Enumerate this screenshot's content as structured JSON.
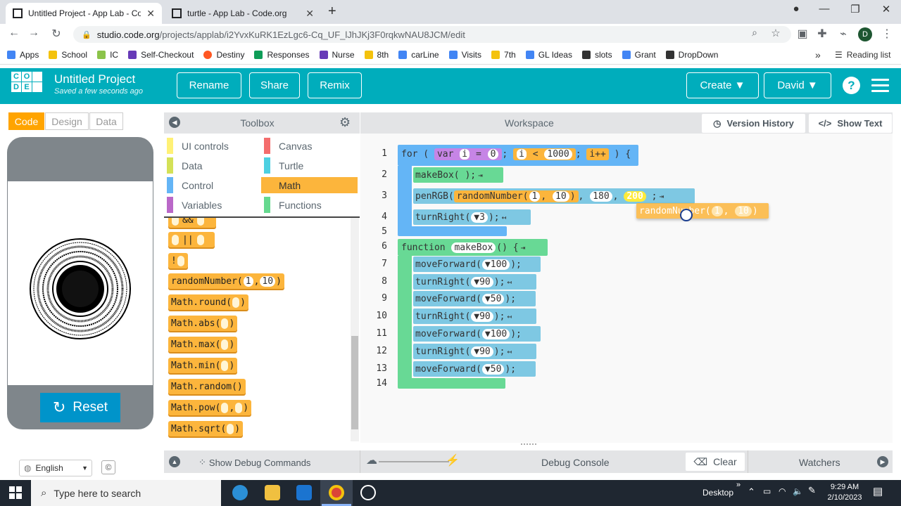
{
  "browser": {
    "tabs": [
      {
        "title": "Untitled Project - App Lab - Code",
        "active": true
      },
      {
        "title": "turtle - App Lab - Code.org",
        "active": false
      }
    ],
    "new_tab": "+",
    "url_host": "studio.code.org",
    "url_path": "/projects/applab/i2YvxKuRK1EzLgc6-Cq_UF_lJhJKj3F0rqkwNAU8JCM/edit",
    "bookmarks": [
      "Apps",
      "School",
      "IC",
      "Self-Checkout",
      "Destiny",
      "Responses",
      "Nurse",
      "8th",
      "carLine",
      "Visits",
      "7th",
      "GL Ideas",
      "slots",
      "Grant",
      "DropDown"
    ],
    "bookmark_more": "»",
    "reading_list": "Reading list",
    "profile_initial": "D"
  },
  "header": {
    "logo_letters": [
      "C",
      "O",
      "D",
      "E"
    ],
    "title": "Untitled Project",
    "subtitle": "Saved a few seconds ago",
    "buttons": {
      "rename": "Rename",
      "share": "Share",
      "remix": "Remix",
      "create": "Create ▼",
      "user": "David ▼"
    },
    "help": "?"
  },
  "left": {
    "mode_tabs": [
      "Code",
      "Design",
      "Data"
    ],
    "reset_label": "Reset",
    "language": "English",
    "cc": "©"
  },
  "toolbox": {
    "title": "Toolbox",
    "categories": [
      {
        "label": "UI controls",
        "color": "#fff176"
      },
      {
        "label": "Canvas",
        "color": "#f46d6d"
      },
      {
        "label": "Data",
        "color": "#d4e157"
      },
      {
        "label": "Turtle",
        "color": "#4dd0e1"
      },
      {
        "label": "Control",
        "color": "#64b5f6"
      },
      {
        "label": "Math",
        "color": "#fcb53c"
      },
      {
        "label": "Variables",
        "color": "#ba68c8"
      },
      {
        "label": "Functions",
        "color": "#66d98f"
      }
    ],
    "blocks": [
      "_ && _",
      "_ || _",
      "!_",
      "randomNumber(1, 10)",
      "Math.round(_)",
      "Math.abs(_)",
      "Math.max(_)",
      "Math.min(_)",
      "Math.random()",
      "Math.pow(_, _)",
      "Math.sqrt(_)"
    ],
    "random_args": [
      "1",
      "10"
    ]
  },
  "workspace": {
    "title": "Workspace",
    "version_history": "Version History",
    "show_text": "Show Text",
    "line_numbers": [
      "1",
      "2",
      "3",
      "4",
      "5",
      "6",
      "7",
      "8",
      "9",
      "10",
      "11",
      "12",
      "13",
      "14"
    ],
    "code": {
      "l1_for": "for",
      "l1_var": "var",
      "l1_i": "i",
      "l1_eq": "=",
      "l1_zero": "0",
      "l1_cond_i": "i",
      "l1_lt": "<",
      "l1_limit": "1000",
      "l1_inc": "i++",
      "l2": "makeBox",
      "l3_fn": "penRGB",
      "l3_rand": "randomNumber",
      "l3_a": "1",
      "l3_b": "10",
      "l3_g": "180",
      "l3_b2": "200",
      "l4_fn": "turnRight",
      "l4_arg": "3",
      "l6_function": "function",
      "l6_name": "makeBox",
      "l7": "moveForward",
      "l7_arg": "100",
      "l8": "turnRight",
      "l8_arg": "90",
      "l9": "moveForward",
      "l9_arg": "50",
      "l10": "turnRight",
      "l10_arg": "90",
      "l11": "moveForward",
      "l11_arg": "100",
      "l12": "turnRight",
      "l12_arg": "90",
      "l13": "moveForward",
      "l13_arg": "50",
      "drag_block": "randomNumber",
      "drag_a": "1",
      "drag_b": "10"
    }
  },
  "debug": {
    "show_debug": "Show Debug Commands",
    "console": "Debug Console",
    "clear": "Clear",
    "watchers": "Watchers"
  },
  "taskbar": {
    "search_placeholder": "Type here to search",
    "desktop": "Desktop",
    "time": "9:29 AM",
    "date": "2/10/2023"
  },
  "colors": {
    "codeorg_teal": "#00adbc",
    "math_orange": "#fcb53c",
    "reset_blue": "#0094ca"
  }
}
